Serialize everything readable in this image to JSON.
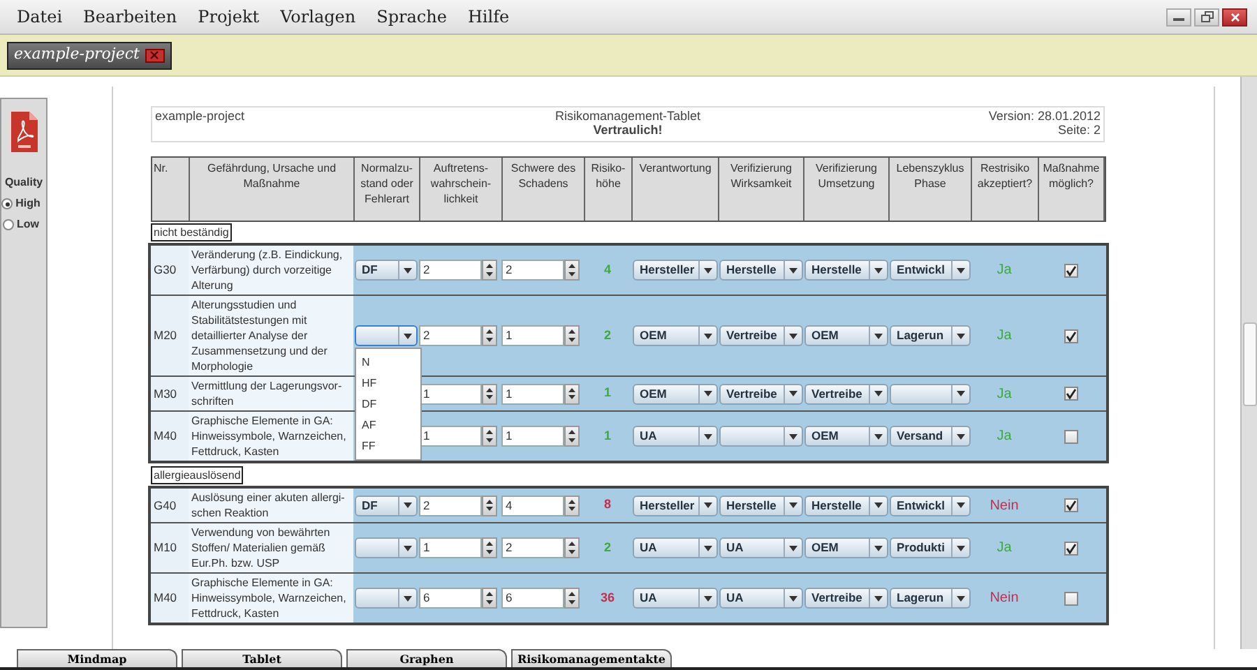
{
  "menu": [
    "Datei",
    "Bearbeiten",
    "Projekt",
    "Vorlagen",
    "Sprache",
    "Hilfe"
  ],
  "project_tabs": [
    {
      "label": "example-project",
      "selected": true
    }
  ],
  "export": {
    "quality_label": "Quality",
    "options": [
      {
        "label": "High",
        "selected": true
      },
      {
        "label": "Low",
        "selected": false
      }
    ]
  },
  "page_header": {
    "project": "example-project",
    "title": "Risikomanagement-Tablet",
    "classification": "Vertraulich!",
    "version": "Version: 28.01.2012",
    "page": "Seite: 2"
  },
  "table": {
    "columns": [
      "Nr.",
      "Gefährdung, Ursache und\nMaßnahme",
      "Normalzu-\nstand oder\nFehlerart",
      "Auftretens-\nwahrschein-\nlichkeit",
      "Schwere des\nSchadens",
      "Risiko-\nhöhe",
      "Verantwortung",
      "Verifizierung\nWirksamkeit",
      "Verifizierung\nUmsetzung",
      "Lebenszyklus\nPhase",
      "Restrisiko\nakzeptiert?",
      "Maßnahme\nmöglich?"
    ],
    "groups": [
      {
        "label": "nicht beständig",
        "rows": [
          {
            "nr": "G30",
            "text": "Veränderung (z.B. Eindickung,\nVerfärbung) durch vorzeitige\nAlterung",
            "fehlerart": {
              "value": "DF",
              "open": false
            },
            "auftreten": "2",
            "schwere": "2",
            "risiko": "4",
            "acceptable": true,
            "verantwortung": "Hersteller",
            "wirksamkeit": "Herstelle",
            "umsetzung": "Herstelle",
            "phase": "Entwickl",
            "restrisiko": "Ja",
            "possible": true
          },
          {
            "nr": "M20",
            "text": "Alterungsstudien und\nStabilitätstestungen mit\ndetaillierter Analyse der\nZusammensetzung und der\nMorphologie",
            "fehlerart": {
              "open": true,
              "options": [
                "N",
                "HF",
                "DF",
                "AF",
                "FF"
              ]
            },
            "auftreten": "2",
            "schwere": "1",
            "risiko": "2",
            "acceptable": true,
            "verantwortung": "OEM",
            "wirksamkeit": "Vertreibe",
            "umsetzung": "OEM",
            "phase": "Lagerun",
            "restrisiko": "Ja",
            "possible": true
          },
          {
            "nr": "M30",
            "text": "Vermittlung der Lagerungsvor-\nschriften",
            "auftreten": "1",
            "schwere": "1",
            "risiko": "1",
            "acceptable": true,
            "verantwortung": "OEM",
            "wirksamkeit": "Vertreibe",
            "umsetzung": "Vertreibe",
            "restrisiko": "Ja",
            "possible": true
          },
          {
            "nr": "M40",
            "text": "Graphische Elemente in GA:\nHinweissymbole, Warnzeichen,\nFettdruck, Kasten",
            "auftreten": "1",
            "schwere": "1",
            "risiko": "1",
            "acceptable": true,
            "verantwortung": "UA",
            "umsetzung": "OEM",
            "phase": "Versand",
            "restrisiko": "Ja",
            "possible": false
          }
        ]
      },
      {
        "label": "allergieauslösend",
        "rows": [
          {
            "nr": "G40",
            "text": "Auslösung einer akuten allergi-\nschen Reaktion",
            "fehlerart": {
              "value": "DF",
              "open": false
            },
            "auftreten": "2",
            "schwere": "4",
            "risiko": "8",
            "acceptable": false,
            "verantwortung": "Hersteller",
            "wirksamkeit": "Herstelle",
            "umsetzung": "Herstelle",
            "phase": "Entwickl",
            "restrisiko": "Nein",
            "possible": true
          },
          {
            "nr": "M10",
            "text": "Verwendung von bewährten\nStoffen/ Materialien gemäß\nEur.Ph. bzw. USP",
            "fehlerart": {
              "open": false
            },
            "auftreten": "1",
            "schwere": "2",
            "risiko": "2",
            "acceptable": true,
            "verantwortung": "UA",
            "wirksamkeit": "UA",
            "umsetzung": "OEM",
            "phase": "Produkti",
            "restrisiko": "Ja",
            "possible": true
          },
          {
            "nr": "M40",
            "text": "Graphische Elemente in GA:\nHinweissymbole, Warnzeichen,\nFettdruck, Kasten",
            "fehlerart": {
              "open": false
            },
            "auftreten": "6",
            "schwere": "6",
            "risiko": "36",
            "acceptable": false,
            "verantwortung": "UA",
            "wirksamkeit": "UA",
            "umsetzung": "Vertreibe",
            "phase": "Lagerun",
            "restrisiko": "Nein",
            "possible": false
          }
        ]
      }
    ]
  },
  "bottom_tabs": [
    "Mindmap",
    "Tablet",
    "Graphen",
    "Risikomanagementakte"
  ]
}
